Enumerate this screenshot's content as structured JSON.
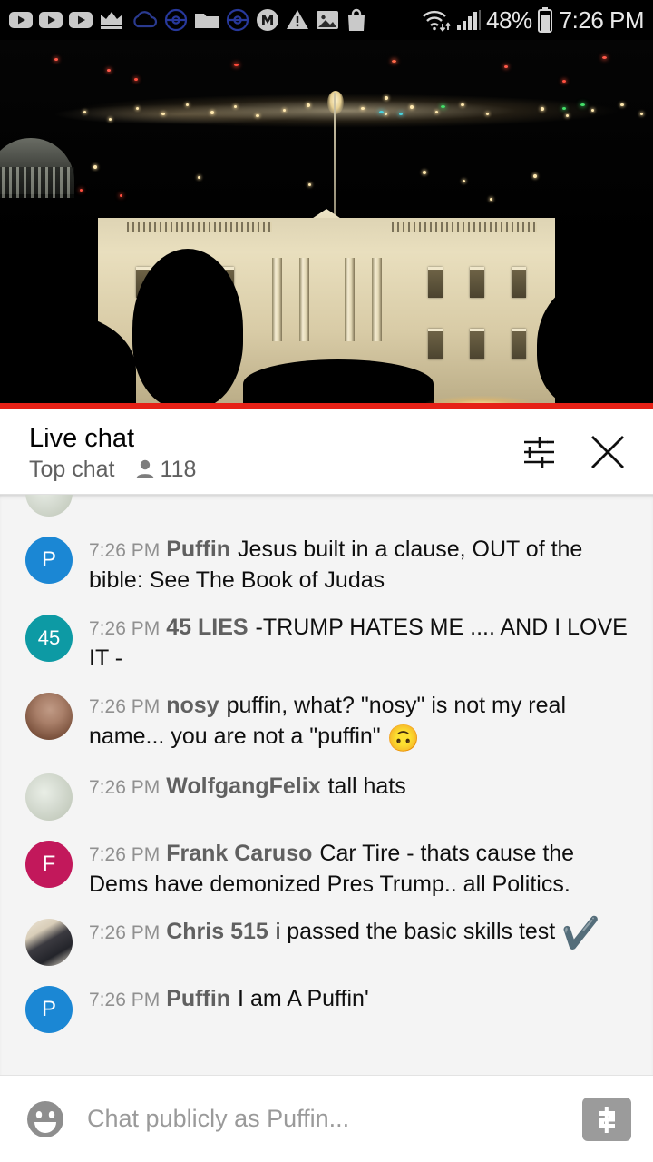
{
  "status_bar": {
    "icons": [
      {
        "name": "youtube-icon-1",
        "label": "YouTube"
      },
      {
        "name": "youtube-icon-2",
        "label": "YouTube"
      },
      {
        "name": "youtube-icon-3",
        "label": "YouTube"
      },
      {
        "name": "crown-icon",
        "label": "Crown"
      },
      {
        "name": "cloud-icon",
        "label": "Cloud"
      },
      {
        "name": "pokeball-icon-1",
        "label": "Pokeball"
      },
      {
        "name": "folder-icon",
        "label": "Folder"
      },
      {
        "name": "pokeball-icon-2",
        "label": "Pokeball"
      },
      {
        "name": "m-badge-icon",
        "label": "M"
      },
      {
        "name": "warning-icon",
        "label": "Warning"
      },
      {
        "name": "image-icon",
        "label": "Image"
      },
      {
        "name": "shopping-bag-icon",
        "label": "Shopping bag"
      }
    ],
    "wifi_icon": "wifi-icon",
    "signal_icon": "cellular-signal-icon",
    "battery_icon": "battery-icon",
    "battery_percent": "48%",
    "clock": "7:26 PM"
  },
  "video": {
    "progress_color": "#e62117",
    "progress_percent": 100
  },
  "chat_header": {
    "title": "Live chat",
    "mode_label": "Top chat",
    "viewer_icon": "person-icon",
    "viewer_count": "118",
    "settings_icon": "chat-settings-sliders-icon",
    "close_icon": "close-icon"
  },
  "messages": [
    {
      "id": "msg-partial-top",
      "timestamp": "",
      "author": "",
      "text": "",
      "avatar_type": "photo-green",
      "avatar_color": "#cdd4c6",
      "avatar_initial": "",
      "partial": true
    },
    {
      "id": "msg-puffin-judas",
      "timestamp": "7:26 PM",
      "author": "Puffin",
      "text": "Jesus built in a clause, OUT of the bible: See The Book of Judas",
      "avatar_type": "initial",
      "avatar_color": "#1b87d4",
      "avatar_initial": "P"
    },
    {
      "id": "msg-45lies-trump",
      "timestamp": "7:26 PM",
      "author": "45 LIES",
      "text": "-TRUMP HATES ME .... AND I LOVE IT -",
      "avatar_type": "initial",
      "avatar_color": "#0d9aa4",
      "avatar_initial": "45"
    },
    {
      "id": "msg-nosy-puffin",
      "timestamp": "7:26 PM",
      "author": "nosy",
      "text": "puffin, what? \"nosy\" is not my real name... you are not a \"puffin\" ",
      "emoji": "🙃",
      "avatar_type": "photo-nose",
      "avatar_color": "#9c6f57",
      "avatar_initial": ""
    },
    {
      "id": "msg-wolfgangfelix-hats",
      "timestamp": "7:26 PM",
      "author": "WolfgangFelix",
      "text": "tall hats",
      "avatar_type": "photo-green",
      "avatar_color": "#cdd4c6",
      "avatar_initial": ""
    },
    {
      "id": "msg-frankcaruso-cartire",
      "timestamp": "7:26 PM",
      "author": "Frank Caruso",
      "text": "Car Tire - thats cause the Dems have demonized Pres Trump.. all Politics.",
      "avatar_type": "initial",
      "avatar_color": "#c2185b",
      "avatar_initial": "F"
    },
    {
      "id": "msg-chris515-skills",
      "timestamp": "7:26 PM",
      "author": "Chris 515",
      "text": "i passed the basic skills test ",
      "emoji": "✔️",
      "avatar_type": "photo-person",
      "avatar_color": "#3b3a40",
      "avatar_initial": ""
    },
    {
      "id": "msg-puffin-iam",
      "timestamp": "7:26 PM",
      "author": "Puffin",
      "text": "I am A Puffin'",
      "avatar_type": "initial",
      "avatar_color": "#1b87d4",
      "avatar_initial": "P"
    }
  ],
  "composer": {
    "emoji_icon": "emoji-smiley-icon",
    "input_value": "",
    "input_placeholder": "Chat publicly as Puffin...",
    "superchat_icon": "super-chat-dollar-icon"
  }
}
